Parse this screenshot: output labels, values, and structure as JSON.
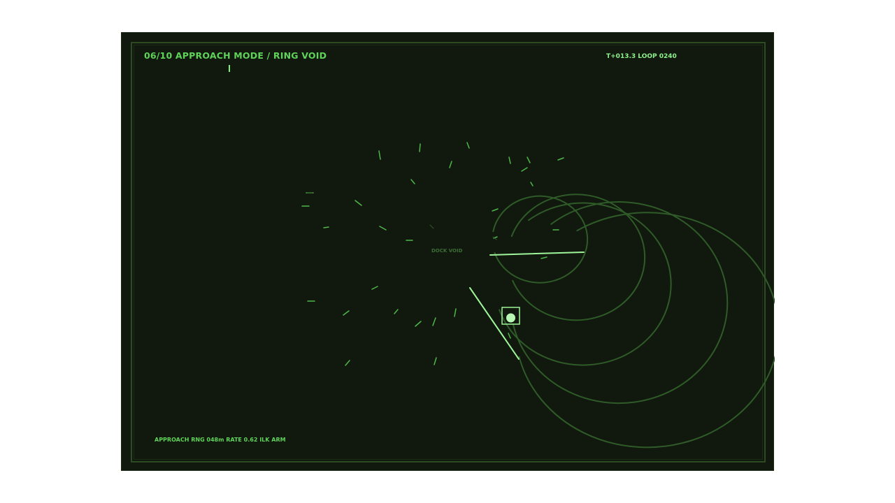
{
  "header": {
    "title": "06/10  APPROACH MODE / RING VOID",
    "clock": "T+013.3  LOOP 0240"
  },
  "radar": {
    "center_label": "DOCK VOID"
  },
  "status_bar": {
    "text": "APPROACH  RNG 048m  RATE 0.62  ILK ARM"
  },
  "colors": {
    "background": "#11180d",
    "frame": "#2c4b22",
    "accent": "#5fd35a",
    "highlight": "#9ef59a",
    "ring": "#2f5b29"
  },
  "icons": {
    "target_marker": "target-square-icon",
    "input_cursor": "text-cursor-icon"
  }
}
